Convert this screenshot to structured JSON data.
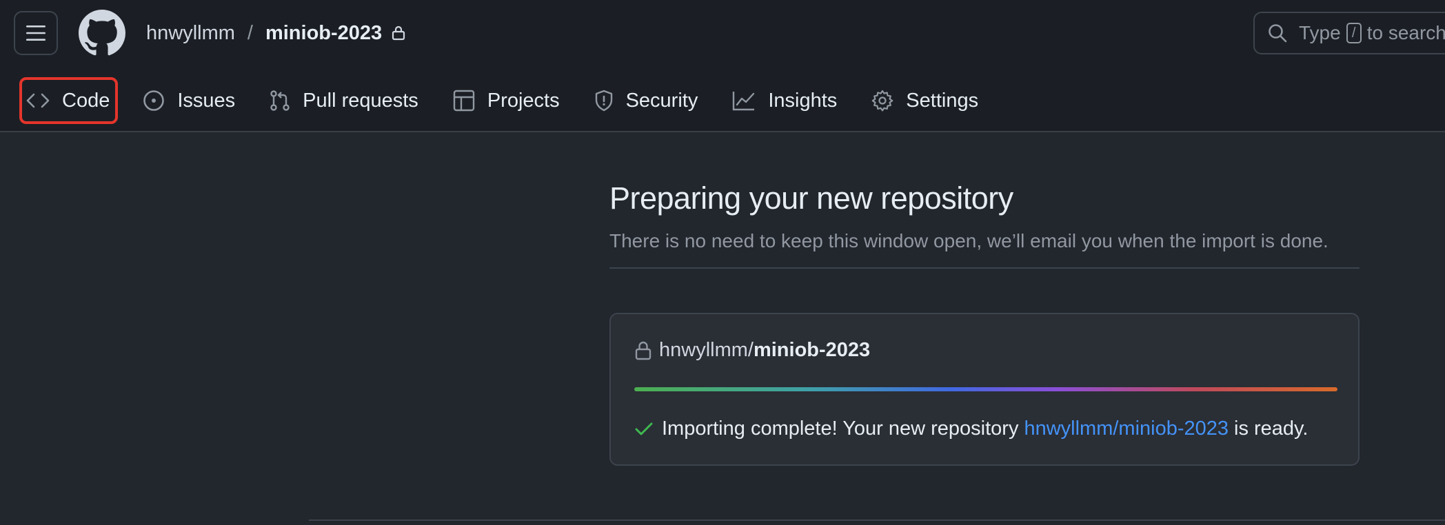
{
  "header": {
    "owner": "hnwyllmm",
    "separator": "/",
    "repo": "miniob-2023",
    "search": {
      "prefix": "Type",
      "key": "/",
      "suffix": "to search"
    }
  },
  "tabs": [
    {
      "label": "Code",
      "icon": "code-icon",
      "active": true
    },
    {
      "label": "Issues",
      "icon": "issue-icon"
    },
    {
      "label": "Pull requests",
      "icon": "pull-request-icon"
    },
    {
      "label": "Projects",
      "icon": "project-table-icon"
    },
    {
      "label": "Security",
      "icon": "shield-icon"
    },
    {
      "label": "Insights",
      "icon": "graph-icon"
    },
    {
      "label": "Settings",
      "icon": "gear-icon"
    }
  ],
  "main": {
    "title": "Preparing your new repository",
    "subtitle": "There is no need to keep this window open, we’ll email you when the import is done.",
    "card": {
      "owner": "hnwyllmm/",
      "repo": "miniob-2023",
      "progress_percent": 100,
      "status_prefix": "Importing complete! Your new repository",
      "status_link": "hnwyllmm/miniob-2023",
      "status_suffix": "is ready."
    }
  },
  "colors": {
    "background": "#22262d",
    "link": "#4493f8",
    "success": "#3fb950",
    "highlight_border": "#e5352b"
  }
}
